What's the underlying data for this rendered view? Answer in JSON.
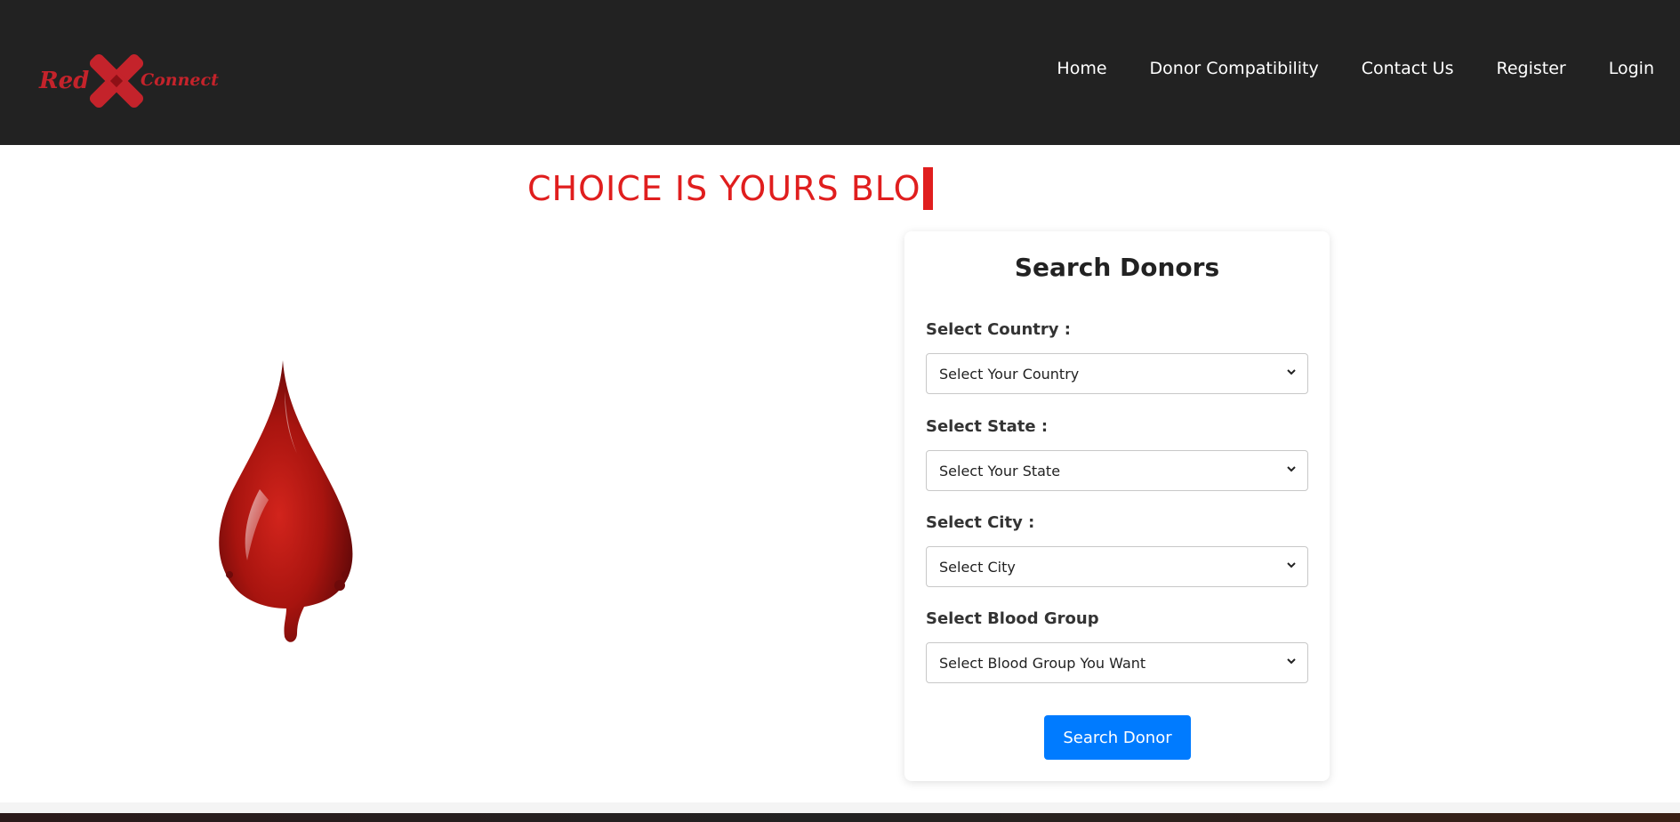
{
  "navbar": {
    "logo": {
      "word_left": "Red",
      "word_right": "Connect",
      "icon": "red-cross-x-icon"
    },
    "links": [
      {
        "label": "Home"
      },
      {
        "label": "Donor Compatibility"
      },
      {
        "label": "Contact Us"
      },
      {
        "label": "Register"
      },
      {
        "label": "Login"
      }
    ]
  },
  "hero": {
    "headline": "CHOICE IS YOURS BLO",
    "image_icon": "blood-drop-icon"
  },
  "search_card": {
    "title": "Search Donors",
    "fields": [
      {
        "label": "Select Country :",
        "selected": "Select Your Country"
      },
      {
        "label": "Select State :",
        "selected": "Select Your State"
      },
      {
        "label": "Select City :",
        "selected": "Select City"
      },
      {
        "label": "Select Blood Group",
        "selected": "Select Blood Group You Want"
      }
    ],
    "button_label": "Search Donor"
  },
  "colors": {
    "navbar_bg": "#222222",
    "accent_red": "#e01e1e",
    "logo_red": "#c4232b",
    "button_blue": "#007bff"
  }
}
